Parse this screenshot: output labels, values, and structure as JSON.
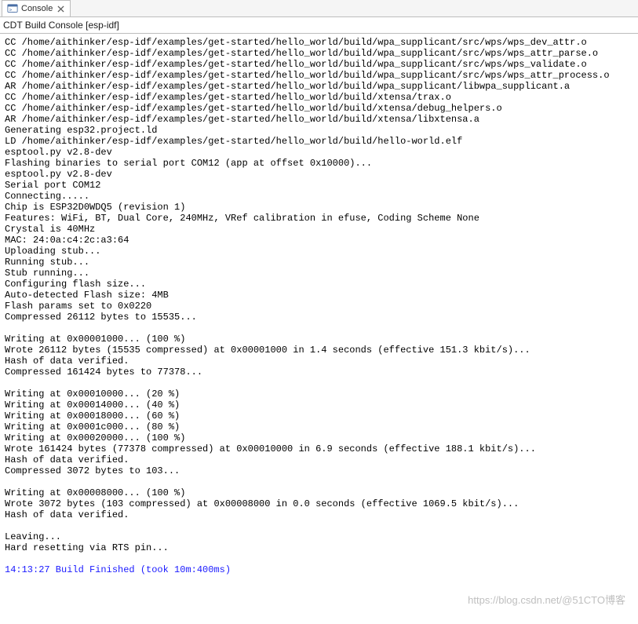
{
  "tab": {
    "title": "Console"
  },
  "subtitle": "CDT Build Console [esp-idf]",
  "watermark": "https://blog.csdn.net/@51CTO博客",
  "build_finished": "14:13:27 Build Finished (took 10m:400ms)",
  "lines": [
    "CC /home/aithinker/esp-idf/examples/get-started/hello_world/build/wpa_supplicant/src/wps/wps_dev_attr.o",
    "CC /home/aithinker/esp-idf/examples/get-started/hello_world/build/wpa_supplicant/src/wps/wps_attr_parse.o",
    "CC /home/aithinker/esp-idf/examples/get-started/hello_world/build/wpa_supplicant/src/wps/wps_validate.o",
    "CC /home/aithinker/esp-idf/examples/get-started/hello_world/build/wpa_supplicant/src/wps/wps_attr_process.o",
    "AR /home/aithinker/esp-idf/examples/get-started/hello_world/build/wpa_supplicant/libwpa_supplicant.a",
    "CC /home/aithinker/esp-idf/examples/get-started/hello_world/build/xtensa/trax.o",
    "CC /home/aithinker/esp-idf/examples/get-started/hello_world/build/xtensa/debug_helpers.o",
    "AR /home/aithinker/esp-idf/examples/get-started/hello_world/build/xtensa/libxtensa.a",
    "Generating esp32.project.ld",
    "LD /home/aithinker/esp-idf/examples/get-started/hello_world/build/hello-world.elf",
    "esptool.py v2.8-dev",
    "Flashing binaries to serial port COM12 (app at offset 0x10000)...",
    "esptool.py v2.8-dev",
    "Serial port COM12",
    "Connecting.....",
    "Chip is ESP32D0WDQ5 (revision 1)",
    "Features: WiFi, BT, Dual Core, 240MHz, VRef calibration in efuse, Coding Scheme None",
    "Crystal is 40MHz",
    "MAC: 24:0a:c4:2c:a3:64",
    "Uploading stub...",
    "Running stub...",
    "Stub running...",
    "Configuring flash size...",
    "Auto-detected Flash size: 4MB",
    "Flash params set to 0x0220",
    "Compressed 26112 bytes to 15535...",
    "",
    "Writing at 0x00001000... (100 %)",
    "Wrote 26112 bytes (15535 compressed) at 0x00001000 in 1.4 seconds (effective 151.3 kbit/s)...",
    "Hash of data verified.",
    "Compressed 161424 bytes to 77378...",
    "",
    "Writing at 0x00010000... (20 %)",
    "Writing at 0x00014000... (40 %)",
    "Writing at 0x00018000... (60 %)",
    "Writing at 0x0001c000... (80 %)",
    "Writing at 0x00020000... (100 %)",
    "Wrote 161424 bytes (77378 compressed) at 0x00010000 in 6.9 seconds (effective 188.1 kbit/s)...",
    "Hash of data verified.",
    "Compressed 3072 bytes to 103...",
    "",
    "Writing at 0x00008000... (100 %)",
    "Wrote 3072 bytes (103 compressed) at 0x00008000 in 0.0 seconds (effective 1069.5 kbit/s)...",
    "Hash of data verified.",
    "",
    "Leaving...",
    "Hard resetting via RTS pin..."
  ]
}
